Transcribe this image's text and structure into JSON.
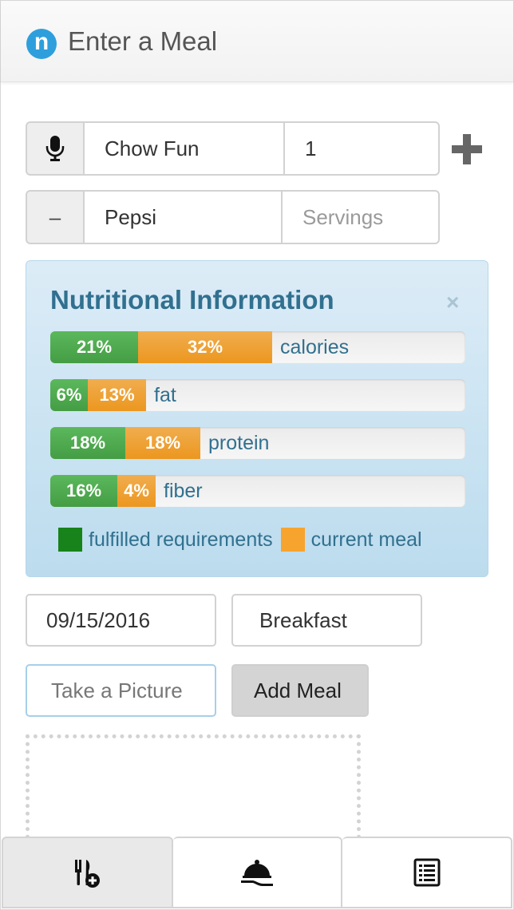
{
  "header": {
    "logo_letter": "n",
    "title": "Enter a Meal"
  },
  "food_rows": [
    {
      "addon_icon": "microphone-icon",
      "food": "Chow Fun",
      "servings": "1",
      "servings_placeholder": "Servings"
    },
    {
      "addon_icon": "minus-icon",
      "addon_text": "–",
      "food": "Pepsi",
      "servings": "",
      "servings_placeholder": "Servings"
    }
  ],
  "add_row_icon": "plus-icon",
  "nutrition": {
    "title": "Nutritional Information",
    "close_label": "×",
    "bars": [
      {
        "label": "calories",
        "fulfilled": "21%",
        "current": "32%",
        "fulfilled_pct": 21,
        "current_pct": 32
      },
      {
        "label": "fat",
        "fulfilled": "6%",
        "current": "13%",
        "fulfilled_pct": 6,
        "current_pct": 13
      },
      {
        "label": "protein",
        "fulfilled": "18%",
        "current": "18%",
        "fulfilled_pct": 18,
        "current_pct": 18
      },
      {
        "label": "fiber",
        "fulfilled": "16%",
        "current": "4%",
        "fulfilled_pct": 16,
        "current_pct": 4
      }
    ],
    "legend": {
      "fulfilled": "fulfilled requirements",
      "current": "current meal"
    },
    "colors": {
      "fulfilled": "#5cb85c",
      "current": "#f0ad4e",
      "legend_fulfilled": "#17831a",
      "legend_current": "#f7a42e",
      "text": "#31708f"
    }
  },
  "meal": {
    "date": "09/15/2016",
    "type": "Breakfast"
  },
  "actions": {
    "take_picture": "Take a Picture",
    "add_meal": "Add Meal"
  },
  "tabs": [
    {
      "icon": "utensils-plus-icon",
      "active": true
    },
    {
      "icon": "serving-cloche-icon",
      "active": false
    },
    {
      "icon": "list-icon",
      "active": false
    }
  ]
}
